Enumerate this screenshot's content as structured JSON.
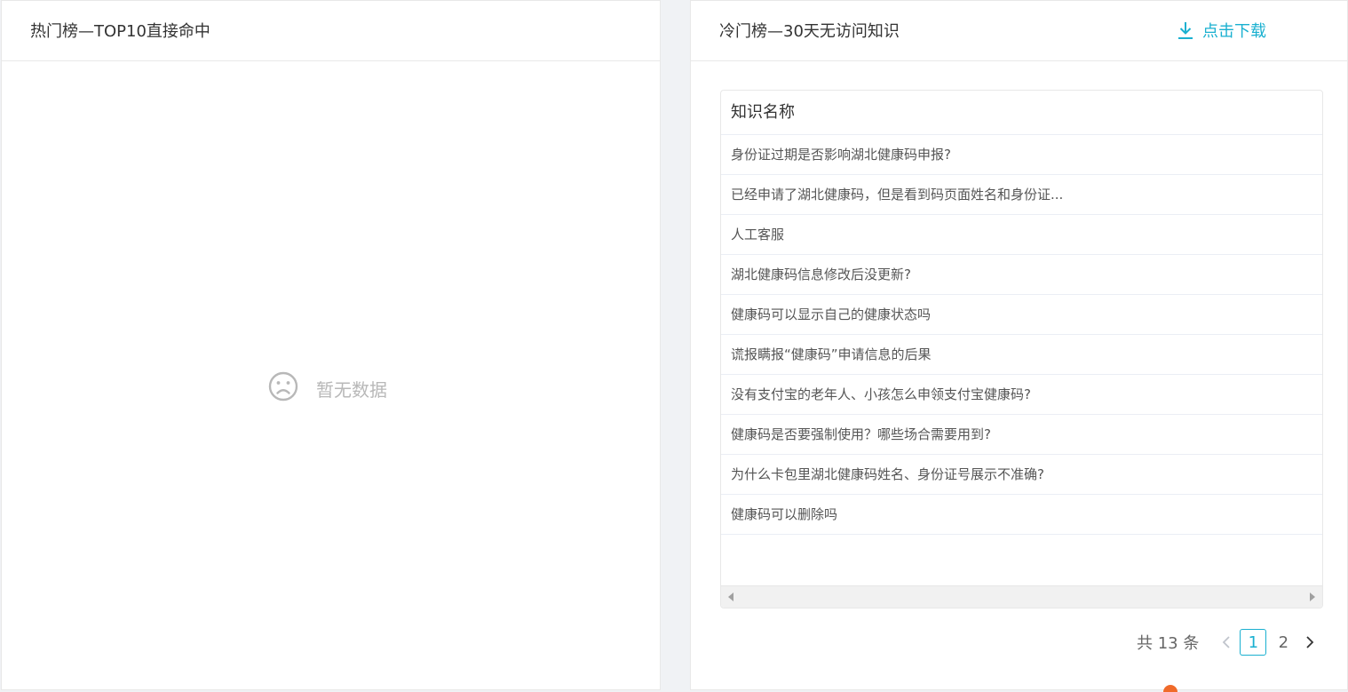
{
  "left_panel": {
    "title": "热门榜—TOP10直接命中",
    "empty_text": "暂无数据",
    "empty_icon": "sad-face-icon"
  },
  "right_panel": {
    "title": "冷门榜—30天无访问知识",
    "download_label": "点击下载",
    "download_icon": "download-icon",
    "accent_color": "#1ab0d0",
    "table": {
      "column": "知识名称",
      "rows": [
        "身份证过期是否影响湖北健康码申报?",
        "已经申请了湖北健康码，但是看到码页面姓名和身份证...",
        "人工客服",
        "湖北健康码信息修改后没更新?",
        "健康码可以显示自己的健康状态吗",
        "谎报瞒报“健康码”申请信息的后果",
        "没有支付宝的老年人、小孩怎么申领支付宝健康码?",
        "健康码是否要强制使用？哪些场合需要用到?",
        "为什么卡包里湖北健康码姓名、身份证号展示不准确?",
        "健康码可以删除吗"
      ]
    },
    "pagination": {
      "total_text": "共 13 条",
      "pages": [
        "1",
        "2"
      ],
      "current": "1"
    }
  }
}
